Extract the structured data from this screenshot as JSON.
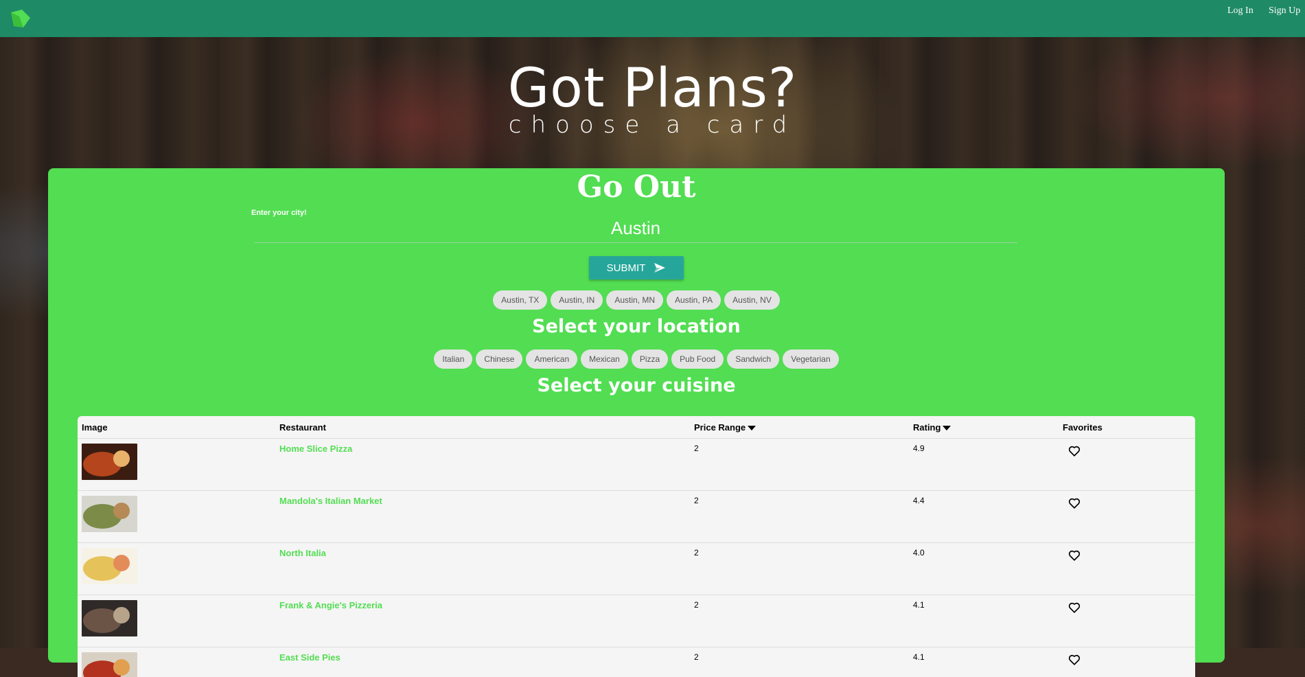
{
  "nav": {
    "login": "Log In",
    "signup": "Sign Up",
    "logo_icon": "logo-icon"
  },
  "hero": {
    "title": "Got Plans?",
    "subtitle": "choose a card"
  },
  "card": {
    "title": "Go Out",
    "city_label": "Enter your city!",
    "city_value": "Austin",
    "submit_label": "SUBMIT",
    "location_chips": [
      "Austin, TX",
      "Austin, IN",
      "Austin, MN",
      "Austin, PA",
      "Austin, NV"
    ],
    "location_heading": "Select your location",
    "cuisine_chips": [
      "Italian",
      "Chinese",
      "American",
      "Mexican",
      "Pizza",
      "Pub Food",
      "Sandwich",
      "Vegetarian"
    ],
    "cuisine_heading": "Select your cuisine"
  },
  "table": {
    "headers": [
      "Image",
      "Restaurant",
      "Price Range",
      "Rating",
      "Favorites"
    ],
    "rows": [
      {
        "name": "Home Slice Pizza",
        "price": "2",
        "rating": "4.9",
        "thumb_colors": [
          "#3a1d10",
          "#b4451c",
          "#e9b26a"
        ]
      },
      {
        "name": "Mandola's Italian Market",
        "price": "2",
        "rating": "4.4",
        "thumb_colors": [
          "#d6d6cf",
          "#7c8b48",
          "#b68a56"
        ]
      },
      {
        "name": "North Italia",
        "price": "2",
        "rating": "4.0",
        "thumb_colors": [
          "#f6f2e6",
          "#e6c25a",
          "#e48b5a"
        ]
      },
      {
        "name": "Frank & Angie's Pizzeria",
        "price": "2",
        "rating": "4.1",
        "thumb_colors": [
          "#2f2a28",
          "#6b5446",
          "#b7a38a"
        ]
      },
      {
        "name": "East Side Pies",
        "price": "2",
        "rating": "4.1",
        "thumb_colors": [
          "#d9d0c4",
          "#b2321f",
          "#e0a050"
        ]
      }
    ]
  },
  "colors": {
    "navbar": "#1f8a66",
    "card": "#52dd52",
    "submit": "#26a69a",
    "link": "#52dd52"
  }
}
